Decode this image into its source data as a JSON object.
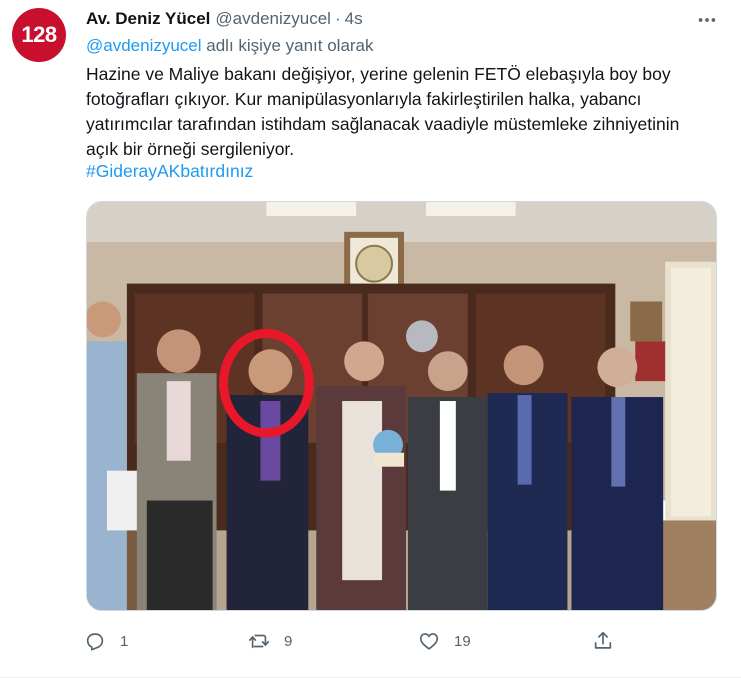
{
  "avatar": {
    "text": "128",
    "color": "#c8102e"
  },
  "author": {
    "display_name": "Av. Deniz Yücel",
    "handle": "@avdenizyucel",
    "separator": "·",
    "time": "4s"
  },
  "replying_to": {
    "mention": "@avdenizyucel",
    "suffix": " adlı kişiye yanıt olarak"
  },
  "body_lines": [
    "Hazine ve Maliye bakanı değişiyor, yerine gelenin FETÖ elebaşıyla boy boy",
    "fotoğrafları çıkıyor. Kur manipülasyonlarıyla fakirleştirilen halka, yabancı",
    "yatırımcılar tarafından istihdam sağlanacak vaadiyle müstemleke zihniyetinin",
    "açık bir örneği sergileniyor."
  ],
  "hashtag": "#GiderayAKbatırdınız",
  "actions": {
    "reply_count": "1",
    "retweet_count": "9",
    "like_count": "19"
  },
  "icons": [
    "more-icon",
    "reply-icon",
    "retweet-icon",
    "like-icon",
    "share-icon"
  ],
  "colors": {
    "link": "#1d9bf0",
    "secondary_text": "#536471",
    "highlight_circle": "#e8182a"
  }
}
